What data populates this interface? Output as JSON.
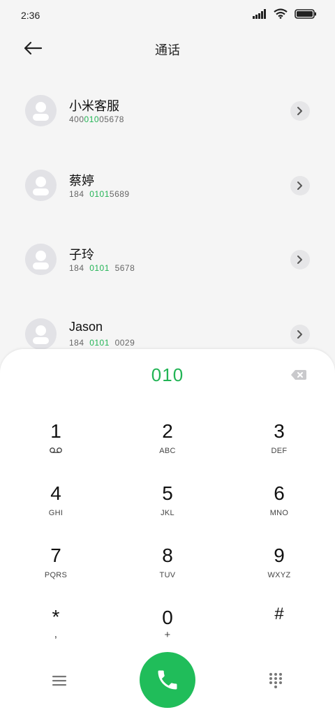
{
  "status_bar": {
    "time": "2:36"
  },
  "header": {
    "title": "通话"
  },
  "contacts": [
    {
      "name": "小米客服",
      "number_parts": [
        "400",
        "010",
        "05678"
      ]
    },
    {
      "name": "蔡婷",
      "number_parts": [
        "184  ",
        "0101",
        "5689"
      ]
    },
    {
      "name": "子玲",
      "number_parts": [
        "184  ",
        "0101",
        "  5678"
      ]
    },
    {
      "name": "Jason",
      "number_parts": [
        "184  ",
        "0101",
        "  0029"
      ]
    }
  ],
  "dialer": {
    "display": "010",
    "keys": [
      {
        "digit": "1",
        "letters": ""
      },
      {
        "digit": "2",
        "letters": "ABC"
      },
      {
        "digit": "3",
        "letters": "DEF"
      },
      {
        "digit": "4",
        "letters": "GHI"
      },
      {
        "digit": "5",
        "letters": "JKL"
      },
      {
        "digit": "6",
        "letters": "MNO"
      },
      {
        "digit": "7",
        "letters": "PQRS"
      },
      {
        "digit": "8",
        "letters": "TUV"
      },
      {
        "digit": "9",
        "letters": "WXYZ"
      },
      {
        "digit": "*",
        "letters": ","
      },
      {
        "digit": "0",
        "letters": "+"
      },
      {
        "digit": "#",
        "letters": ""
      }
    ]
  },
  "colors": {
    "accent": "#20bd5a",
    "highlight_text": "#22b455",
    "background": "#f5f5f5",
    "dialer_bg": "#ffffff"
  },
  "icons": [
    "back-arrow-icon",
    "signal-icon",
    "wifi-icon",
    "battery-icon",
    "chevron-right-icon",
    "backspace-icon",
    "voicemail-icon",
    "menu-icon",
    "phone-icon",
    "keypad-icon"
  ]
}
